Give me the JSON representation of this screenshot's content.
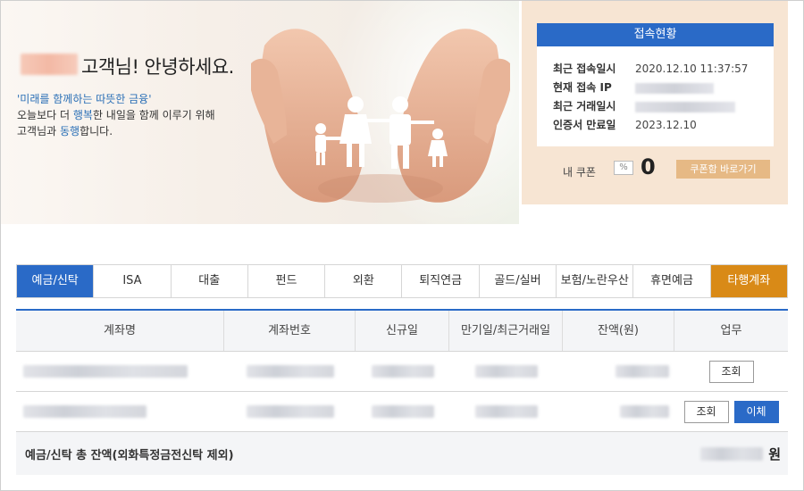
{
  "hero": {
    "greeting": "고객님! 안녕하세요.",
    "slogan": "'미래를 함께하는 따뜻한 금융'",
    "desc_line1_a": "오늘보다 더 ",
    "desc_line1_hl": "행복",
    "desc_line1_b": "한 내일을 함께 이루기 위해",
    "desc_line2_a": "고객님과 ",
    "desc_line2_hl": "동행",
    "desc_line2_b": "합니다."
  },
  "status": {
    "title": "접속현황",
    "rows": [
      {
        "label": "최근 접속일시",
        "value": "2020.12.10 11:37:57"
      },
      {
        "label": "현재 접속 IP",
        "value": ""
      },
      {
        "label": "최근 거래일시",
        "value": ""
      },
      {
        "label": "인증서 만료일",
        "value": "2023.12.10"
      }
    ],
    "coupon_label": "내 쿠폰",
    "coupon_pct": "%",
    "coupon_count": "0",
    "coupon_button": "쿠폰함 바로가기"
  },
  "tabs": [
    "예금/신탁",
    "ISA",
    "대출",
    "펀드",
    "외환",
    "퇴직연금",
    "골드/실버",
    "보험/노란우산",
    "휴면예금",
    "타행계좌"
  ],
  "table": {
    "headers": [
      "계좌명",
      "계좌번호",
      "신규일",
      "만기일/최근거래일",
      "잔액(원)",
      "업무"
    ],
    "view_button": "조회",
    "transfer_button": "이체",
    "total_label": "예금/신탁 총 잔액(외화특정금전신탁 제외)",
    "total_unit": "원"
  },
  "colors": {
    "primary": "#2a6ac7",
    "accent": "#d98a17",
    "status_bg": "#f7e5d3",
    "coupon_btn": "#e6b985"
  }
}
